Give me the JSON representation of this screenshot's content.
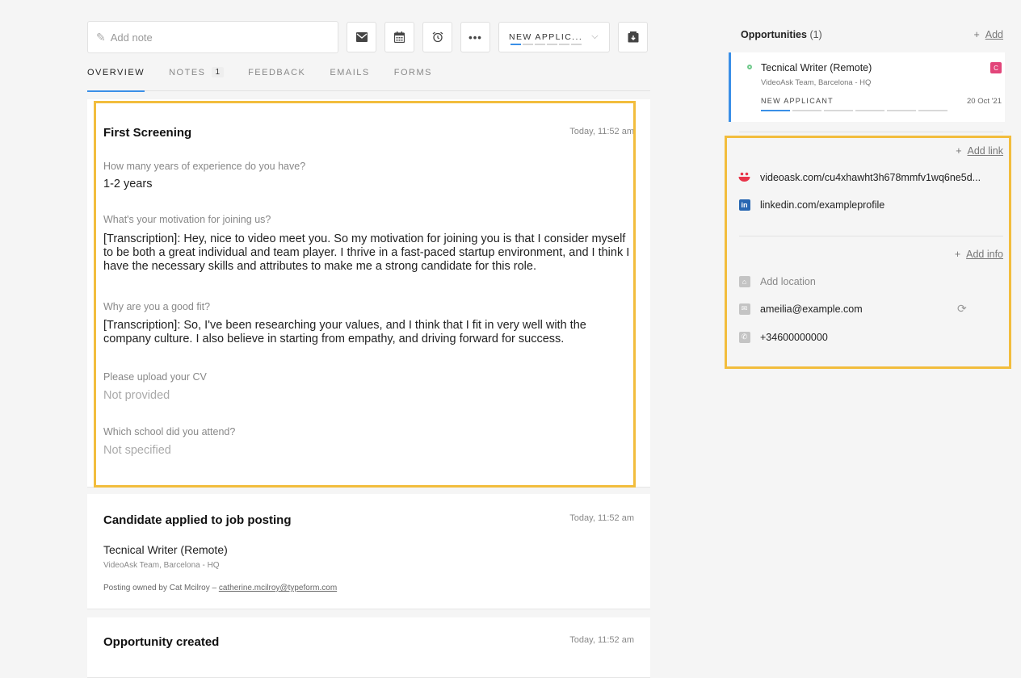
{
  "toolbar": {
    "note_placeholder": "Add note",
    "status_label": "NEW APPLIC...",
    "stage_progress": [
      true,
      false,
      false,
      false,
      false,
      false
    ]
  },
  "tabs": [
    {
      "label": "OVERVIEW",
      "active": true
    },
    {
      "label": "NOTES",
      "badge": "1"
    },
    {
      "label": "FEEDBACK"
    },
    {
      "label": "EMAILS"
    },
    {
      "label": "FORMS"
    }
  ],
  "screening": {
    "title": "First Screening",
    "time": "Today, 11:52 am",
    "questions": [
      {
        "q": "How many years of experience do you have?",
        "a": "1-2 years"
      },
      {
        "q": "What's your motivation for joining us?",
        "a": "[Transcription]: Hey, nice to video meet you. So my motivation for joining you is that I consider myself to be both a great individual and team player. I thrive in a fast-paced startup environment, and I think I have the necessary skills and attributes to make me a strong candidate for this role."
      },
      {
        "q": "Why are you a good fit?",
        "a": "[Transcription]: So, I've been researching your values, and I think that I fit in very well with the company culture. I also believe in starting from empathy, and driving forward for success."
      },
      {
        "q": "Please upload your CV",
        "a": "Not provided"
      },
      {
        "q": "Which school did you attend?",
        "a": "Not specified"
      }
    ]
  },
  "applied": {
    "title": "Candidate applied to job posting",
    "time": "Today, 11:52 am",
    "job": "Tecnical Writer (Remote)",
    "team": "VideoAsk Team, Barcelona - HQ",
    "owner_prefix": "Posting owned by Cat Mcilroy – ",
    "owner_email": "catherine.mcilroy@typeform.com"
  },
  "created": {
    "title": "Opportunity created",
    "time": "Today, 11:52 am"
  },
  "opportunities": {
    "heading": "Opportunities",
    "count": "(1)",
    "add_label": "Add",
    "card": {
      "title": "Tecnical Writer (Remote)",
      "team": "VideoAsk Team, Barcelona - HQ",
      "stage": "NEW APPLICANT",
      "date": "20 Oct '21",
      "tag": "C",
      "stage_progress": [
        true,
        false,
        false,
        false,
        false,
        false
      ]
    }
  },
  "links": {
    "add_label": "Add link",
    "items": [
      "videoask.com/cu4xhawht3h678mmfv1wq6ne5d...",
      "linkedin.com/exampleprofile"
    ]
  },
  "info": {
    "add_label": "Add info",
    "location": "Add location",
    "email": "ameilia@example.com",
    "phone": "+34600000000"
  }
}
